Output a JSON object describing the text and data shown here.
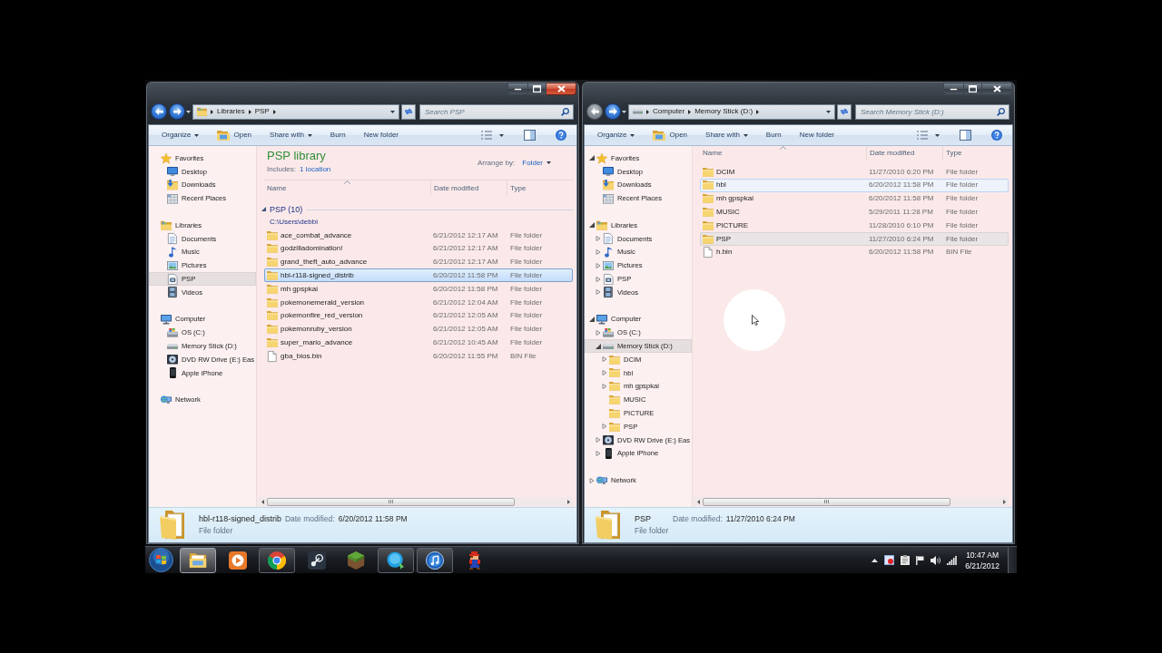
{
  "windows": [
    {
      "active": true,
      "nav_buttons": [
        {
          "kind": "back",
          "disabled": false
        },
        {
          "kind": "forward",
          "disabled": false
        }
      ],
      "address": {
        "kind": "libraries",
        "segments": [
          "Libraries",
          "PSP"
        ]
      },
      "search": {
        "placeholder": "Search PSP"
      },
      "toolbar": [
        {
          "label": "Organize",
          "kind": "menu"
        },
        {
          "label": "Open",
          "kind": "open"
        },
        {
          "label": "Share with",
          "kind": "menu"
        },
        {
          "label": "Burn",
          "kind": "plain"
        },
        {
          "label": "New folder",
          "kind": "plain"
        }
      ],
      "nav": [
        {
          "label": "Favorites",
          "kind": "favorites",
          "selected": false,
          "children": [
            {
              "label": "Desktop",
              "kind": "desktop",
              "selected": false
            },
            {
              "label": "Downloads",
              "kind": "downloads",
              "selected": false
            },
            {
              "label": "Recent Places",
              "kind": "recent",
              "selected": false
            }
          ]
        },
        {
          "label": "Libraries",
          "kind": "libraries",
          "selected": false,
          "children": [
            {
              "label": "Documents",
              "kind": "documents",
              "selected": false
            },
            {
              "label": "Music",
              "kind": "music",
              "selected": false
            },
            {
              "label": "Pictures",
              "kind": "pictures",
              "selected": false
            },
            {
              "label": "PSP",
              "kind": "device",
              "selected": true
            },
            {
              "label": "Videos",
              "kind": "videos",
              "selected": false
            }
          ]
        },
        {
          "label": "Computer",
          "kind": "computer",
          "selected": false,
          "children": [
            {
              "label": "OS (C:)",
              "kind": "osdrive",
              "selected": false
            },
            {
              "label": "Memory Stick (D:)",
              "kind": "stick",
              "selected": false
            },
            {
              "label": "DVD RW Drive (E:) Eas",
              "kind": "dvd",
              "selected": false
            },
            {
              "label": "Apple iPhone",
              "kind": "phone",
              "selected": false
            }
          ]
        },
        {
          "label": "Network",
          "kind": "network",
          "selected": false
        }
      ],
      "library": {
        "title": "PSP library",
        "includes_label": "Includes:",
        "locations_link": "1 location",
        "arrange_label": "Arrange by:",
        "arrange_value": "Folder"
      },
      "columns": [
        {
          "label": "Name",
          "sorted": true
        },
        {
          "label": "Date modified",
          "sorted": false
        },
        {
          "label": "Type",
          "sorted": false
        }
      ],
      "group": {
        "label": "PSP (10)",
        "path": "C:\\Users\\debbi",
        "expanded": true
      },
      "rows": [
        {
          "name": "ace_combat_advance",
          "date": "6/21/2012 12:17 AM",
          "type": "File folder",
          "kind": "folder",
          "selected": false
        },
        {
          "name": "godzilladomination!",
          "date": "6/21/2012 12:17 AM",
          "type": "File folder",
          "kind": "folder",
          "selected": false
        },
        {
          "name": "grand_theft_auto_advance",
          "date": "6/21/2012 12:17 AM",
          "type": "File folder",
          "kind": "folder",
          "selected": false
        },
        {
          "name": "hbl-r118-signed_distrib",
          "date": "6/20/2012 11:58 PM",
          "type": "File folder",
          "kind": "folder",
          "selected": true
        },
        {
          "name": "mh gpspkai",
          "date": "6/20/2012 11:58 PM",
          "type": "File folder",
          "kind": "folder",
          "selected": false
        },
        {
          "name": "pokemonemerald_version",
          "date": "6/21/2012 12:04 AM",
          "type": "File folder",
          "kind": "folder",
          "selected": false
        },
        {
          "name": "pokemonfire_red_version",
          "date": "6/21/2012 12:05 AM",
          "type": "File folder",
          "kind": "folder",
          "selected": false
        },
        {
          "name": "pokemonruby_version",
          "date": "6/21/2012 12:05 AM",
          "type": "File folder",
          "kind": "folder",
          "selected": false
        },
        {
          "name": "super_mario_advance",
          "date": "6/21/2012 10:45 AM",
          "type": "File folder",
          "kind": "folder",
          "selected": false
        },
        {
          "name": "gba_bios.bin",
          "date": "6/20/2012 11:55 PM",
          "type": "BIN File",
          "kind": "file",
          "selected": false
        }
      ],
      "details": {
        "name": "hbl-r118-signed_distrib",
        "date_label": "Date modified:",
        "date": "6/20/2012 11:58 PM",
        "type": "File folder"
      }
    },
    {
      "active": false,
      "nav_buttons": [
        {
          "kind": "back",
          "disabled": true
        },
        {
          "kind": "forward",
          "disabled": false
        }
      ],
      "address": {
        "kind": "stick",
        "segments": [
          "Computer",
          "Memory Stick (D:)"
        ]
      },
      "search": {
        "placeholder": "Search Memory Stick (D:)"
      },
      "toolbar": [
        {
          "label": "Organize",
          "kind": "menu"
        },
        {
          "label": "Open",
          "kind": "open"
        },
        {
          "label": "Share with",
          "kind": "menu"
        },
        {
          "label": "Burn",
          "kind": "plain"
        },
        {
          "label": "New folder",
          "kind": "plain"
        }
      ],
      "nav": [
        {
          "label": "Favorites",
          "kind": "favorites",
          "expanded": true,
          "selected": false,
          "children": [
            {
              "label": "Desktop",
              "kind": "desktop",
              "selected": false
            },
            {
              "label": "Downloads",
              "kind": "downloads",
              "selected": false
            },
            {
              "label": "Recent Places",
              "kind": "recent",
              "selected": false
            }
          ]
        },
        {
          "label": "Libraries",
          "kind": "libraries",
          "expanded": true,
          "selected": false,
          "children": [
            {
              "label": "Documents",
              "kind": "documents",
              "expanded": false,
              "selected": false
            },
            {
              "label": "Music",
              "kind": "music",
              "expanded": false,
              "selected": false
            },
            {
              "label": "Pictures",
              "kind": "pictures",
              "expanded": false,
              "selected": false
            },
            {
              "label": "PSP",
              "kind": "device",
              "expanded": false,
              "selected": false
            },
            {
              "label": "Videos",
              "kind": "videos",
              "expanded": false,
              "selected": false
            }
          ]
        },
        {
          "label": "Computer",
          "kind": "computer",
          "expanded": true,
          "selected": false,
          "children": [
            {
              "label": "OS (C:)",
              "kind": "osdrive",
              "expanded": false,
              "selected": false
            },
            {
              "label": "Memory Stick (D:)",
              "kind": "stick",
              "expanded": true,
              "selected": true,
              "children": [
                {
                  "label": "DCIM",
                  "kind": "folder",
                  "expanded": false,
                  "selected": false
                },
                {
                  "label": "hbl",
                  "kind": "folder",
                  "expanded": false,
                  "selected": false
                },
                {
                  "label": "mh gpspkai",
                  "kind": "folder",
                  "expanded": false,
                  "selected": false
                },
                {
                  "label": "MUSIC",
                  "kind": "folder",
                  "selected": false
                },
                {
                  "label": "PICTURE",
                  "kind": "folder",
                  "selected": false
                },
                {
                  "label": "PSP",
                  "kind": "folder",
                  "expanded": false,
                  "selected": false
                }
              ]
            },
            {
              "label": "DVD RW Drive (E:) Eas",
              "kind": "dvd",
              "expanded": false,
              "selected": false
            },
            {
              "label": "Apple iPhone",
              "kind": "phone",
              "expanded": false,
              "selected": false
            }
          ]
        },
        {
          "label": "Network",
          "kind": "network",
          "expanded": false,
          "selected": false
        }
      ],
      "columns": [
        {
          "label": "Name",
          "sorted": true
        },
        {
          "label": "Date modified",
          "sorted": false
        },
        {
          "label": "Type",
          "sorted": false
        }
      ],
      "rows": [
        {
          "name": "DCIM",
          "date": "11/27/2010 6:20 PM",
          "type": "File folder",
          "kind": "folder",
          "selected": false,
          "hot": false
        },
        {
          "name": "hbl",
          "date": "6/20/2012 11:58 PM",
          "type": "File folder",
          "kind": "folder",
          "selected": false,
          "hot": true
        },
        {
          "name": "mh gpspkai",
          "date": "6/20/2012 11:58 PM",
          "type": "File folder",
          "kind": "folder",
          "selected": false,
          "hot": false
        },
        {
          "name": "MUSIC",
          "date": "5/29/2011 11:28 PM",
          "type": "File folder",
          "kind": "folder",
          "selected": false,
          "hot": false
        },
        {
          "name": "PICTURE",
          "date": "11/28/2010 6:10 PM",
          "type": "File folder",
          "kind": "folder",
          "selected": false,
          "hot": false
        },
        {
          "name": "PSP",
          "date": "11/27/2010 6:24 PM",
          "type": "File folder",
          "kind": "folder",
          "selected": true,
          "hot": false
        },
        {
          "name": "h.bin",
          "date": "6/20/2012 11:58 PM",
          "type": "BIN File",
          "kind": "file",
          "selected": false,
          "hot": false
        }
      ],
      "details": {
        "name": "PSP",
        "date_label": "Date modified:",
        "date": "11/27/2010 6:24 PM",
        "type": "File folder"
      },
      "cursor": {
        "highlighted": true
      }
    }
  ],
  "taskbar": {
    "apps": [
      {
        "kind": "explorer",
        "running": true,
        "active": true
      },
      {
        "kind": "media",
        "running": false,
        "active": false
      },
      {
        "kind": "browser",
        "running": true,
        "active": false
      },
      {
        "kind": "gameclient",
        "running": false,
        "active": false
      },
      {
        "kind": "blockgame",
        "running": false,
        "active": false
      },
      {
        "kind": "messenger",
        "running": true,
        "active": false
      },
      {
        "kind": "jukebox",
        "running": true,
        "active": false
      },
      {
        "kind": "retrogame",
        "running": false,
        "active": false
      }
    ],
    "clock": {
      "time": "10:47 AM",
      "date": "6/21/2012"
    }
  }
}
